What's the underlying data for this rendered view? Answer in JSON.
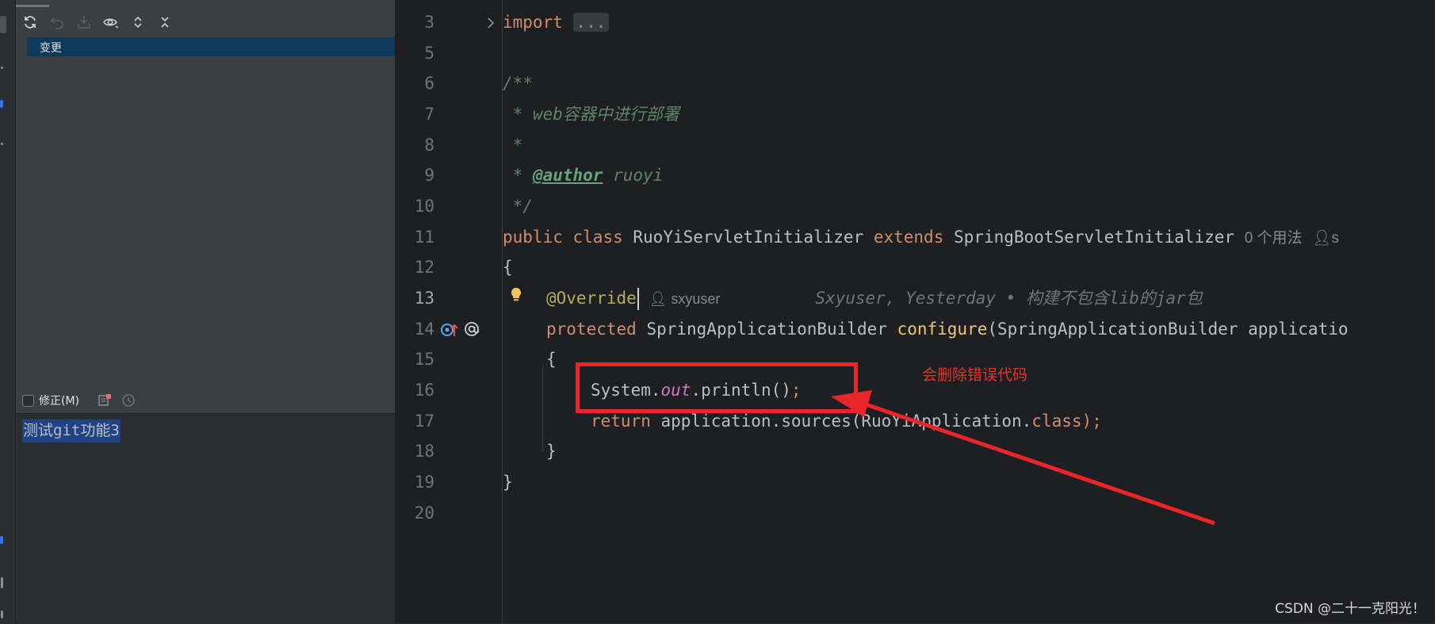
{
  "commit_panel": {
    "toolbar": {
      "icons": [
        "refresh-icon",
        "rollback-icon",
        "shelve-icon",
        "preview-icon",
        "expand-all-icon",
        "collapse-all-icon"
      ]
    },
    "changes_node_label": "变更",
    "amend_label": "修正(M)",
    "commit_message": "测试git功能3"
  },
  "editor": {
    "lines": [
      {
        "num": "3"
      },
      {
        "num": "5"
      },
      {
        "num": "6"
      },
      {
        "num": "7"
      },
      {
        "num": "8"
      },
      {
        "num": "9"
      },
      {
        "num": "10"
      },
      {
        "num": "11"
      },
      {
        "num": "12"
      },
      {
        "num": "13"
      },
      {
        "num": "14"
      },
      {
        "num": "15"
      },
      {
        "num": "16"
      },
      {
        "num": "17"
      },
      {
        "num": "18"
      },
      {
        "num": "19"
      },
      {
        "num": "20"
      }
    ],
    "code": {
      "l3_kw": "import",
      "l3_fold": "...",
      "l6": "/**",
      "l7_star": " * ",
      "l7_text": "web容器中进行部署",
      "l8": " *",
      "l9_star": " * ",
      "l9_tag": "@author",
      "l9_text": " ruoyi",
      "l10": " */",
      "l11_public": "public",
      "l11_class": "class",
      "l11_name": "RuoYiServletInitializer",
      "l11_extends": "extends",
      "l11_super": "SpringBootServletInitializer",
      "l11_hint": "0 个用法",
      "l11_author_hint": "s",
      "l12": "{",
      "l13_annotation": "@Override",
      "l13_author": "sxyuser",
      "l13_blame": "Sxyuser, Yesterday • 构建不包含lib的jar包",
      "l14_protected": "protected",
      "l14_type": "SpringApplicationBuilder",
      "l14_method": "configure",
      "l14_params": "(SpringApplicationBuilder applicatio",
      "l15": "{",
      "l16_system": "System.",
      "l16_out": "out",
      "l16_rest": ".println()",
      "l16_semi": ";",
      "l17_return": "return",
      "l17_rest": " application.sources(RuoYiApplication.",
      "l17_class": "class",
      "l17_end": ");",
      "l18": "}",
      "l19": "}"
    }
  },
  "annotation": {
    "note": "会删除错误代码",
    "color": "#e8262a"
  },
  "watermark": "CSDN @二十一克阳光！",
  "colors": {
    "keyword": "#cf8e6d",
    "comment": "#5f826b",
    "annotation": "#b3ae60",
    "selection": "#214283"
  }
}
